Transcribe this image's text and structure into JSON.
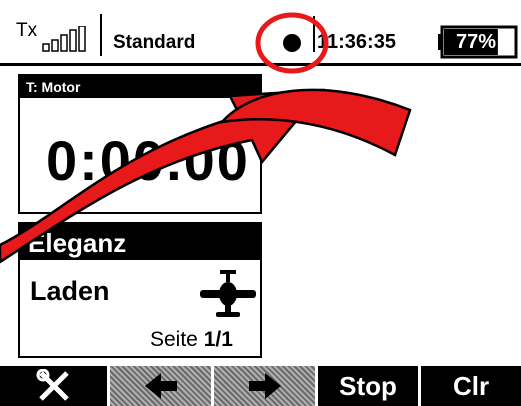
{
  "status": {
    "tx_label": "Tx",
    "model_name": "Standard",
    "clock": "11:36:35",
    "battery": "77%",
    "battery_level": 0.77
  },
  "timer": {
    "title": "T: Motor",
    "value": "0:00.00"
  },
  "model": {
    "name": "Eleganz",
    "action": "Laden",
    "page_label": "Seite",
    "page_value": "1/1"
  },
  "softkeys": {
    "settings_icon": "wrench-screwdriver-icon",
    "left_icon": "arrow-left-icon",
    "right_icon": "arrow-right-icon",
    "stop": "Stop",
    "clr": "Clr"
  },
  "colors": {
    "annotation": "#e8191a"
  }
}
